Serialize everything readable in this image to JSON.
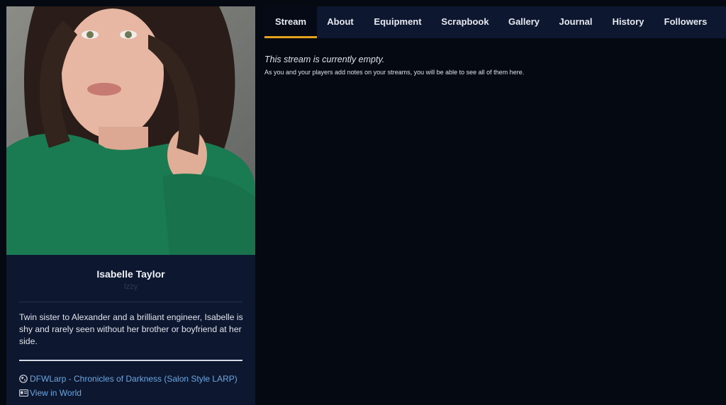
{
  "profile": {
    "name": "Isabelle Taylor",
    "nickname": "Izzy",
    "bio": "Twin sister to Alexander and a brilliant engineer, Isabelle is shy and rarely seen without her brother or boyfriend at her side.",
    "links": [
      {
        "label": "DFWLarp - Chronicles of Darkness (Salon Style LARP)",
        "icon": "globe-icon"
      },
      {
        "label": "View in World",
        "icon": "id-card-icon"
      }
    ]
  },
  "tabs": [
    {
      "label": "Stream",
      "active": true
    },
    {
      "label": "About"
    },
    {
      "label": "Equipment"
    },
    {
      "label": "Scrapbook"
    },
    {
      "label": "Gallery"
    },
    {
      "label": "Journal"
    },
    {
      "label": "History"
    },
    {
      "label": "Followers"
    }
  ],
  "stream": {
    "empty_title": "This stream is currently empty.",
    "empty_subtitle": "As you and your players add notes on your streams, you will be able to see all of them here."
  },
  "colors": {
    "accent": "#e3a21a",
    "link": "#6ba7e0",
    "panel": "#0d1730",
    "background": "#050912"
  }
}
